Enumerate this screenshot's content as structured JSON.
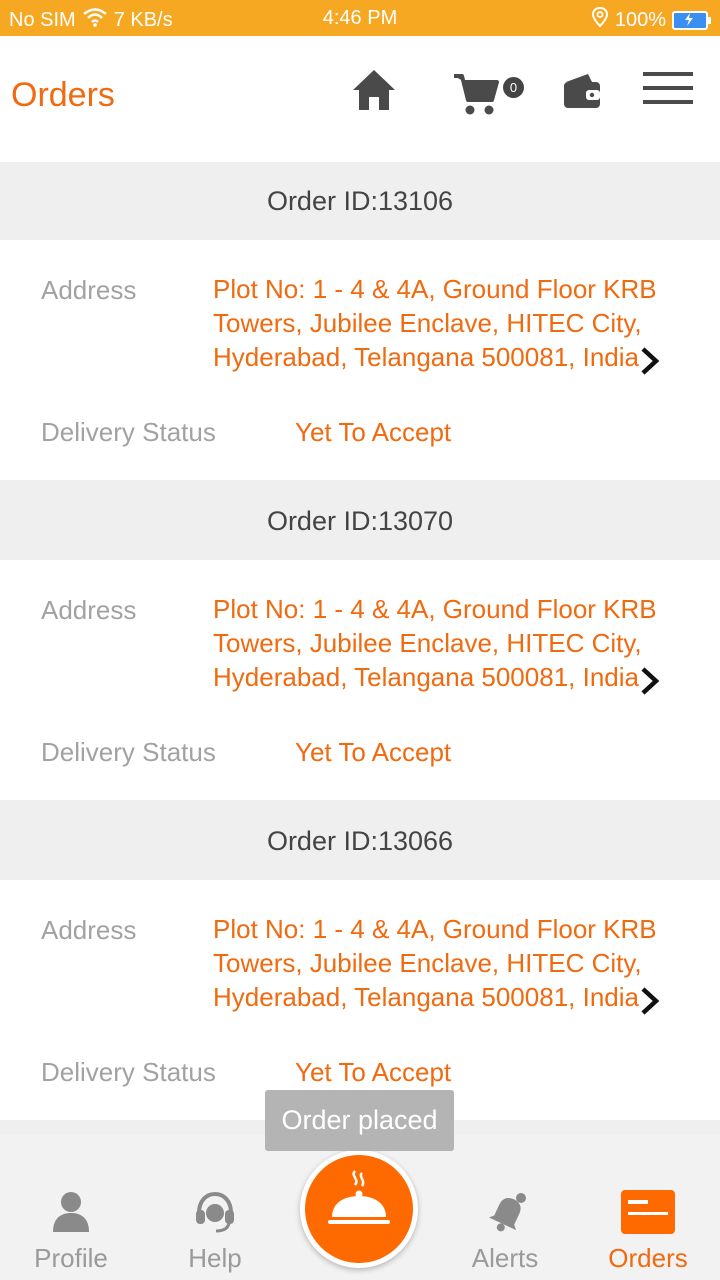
{
  "status_bar": {
    "carrier": "No SIM",
    "speed": "7 KB/s",
    "time": "4:46 PM",
    "battery": "100%"
  },
  "header": {
    "title": "Orders",
    "cart_count": "0"
  },
  "orders": [
    {
      "id": "Order ID:13106",
      "address_label": "Address",
      "address_lines": [
        "Plot No: 1 - 4 & 4A, Ground Floor KRB",
        "Towers, Jubilee Enclave, HITEC City,",
        "Hyderabad, Telangana 500081, India"
      ],
      "status_label": "Delivery Status",
      "status": "Yet To Accept"
    },
    {
      "id": "Order ID:13070",
      "address_label": "Address",
      "address_lines": [
        "Plot No: 1 - 4 & 4A, Ground Floor KRB",
        "Towers, Jubilee Enclave, HITEC City,",
        "Hyderabad, Telangana 500081, India"
      ],
      "status_label": "Delivery Status",
      "status": "Yet To Accept"
    },
    {
      "id": "Order ID:13066",
      "address_label": "Address",
      "address_lines": [
        "Plot No: 1 - 4 & 4A, Ground Floor KRB",
        "Towers, Jubilee Enclave, HITEC City,",
        "Hyderabad, Telangana 500081, India"
      ],
      "status_label": "Delivery Status",
      "status": "Yet To Accept"
    }
  ],
  "toast": "Order placed",
  "bottom_nav": {
    "profile": "Profile",
    "help": "Help",
    "alerts": "Alerts",
    "orders": "Orders"
  },
  "colors": {
    "accent": "#f06a0f",
    "status_bar": "#f6a823"
  }
}
